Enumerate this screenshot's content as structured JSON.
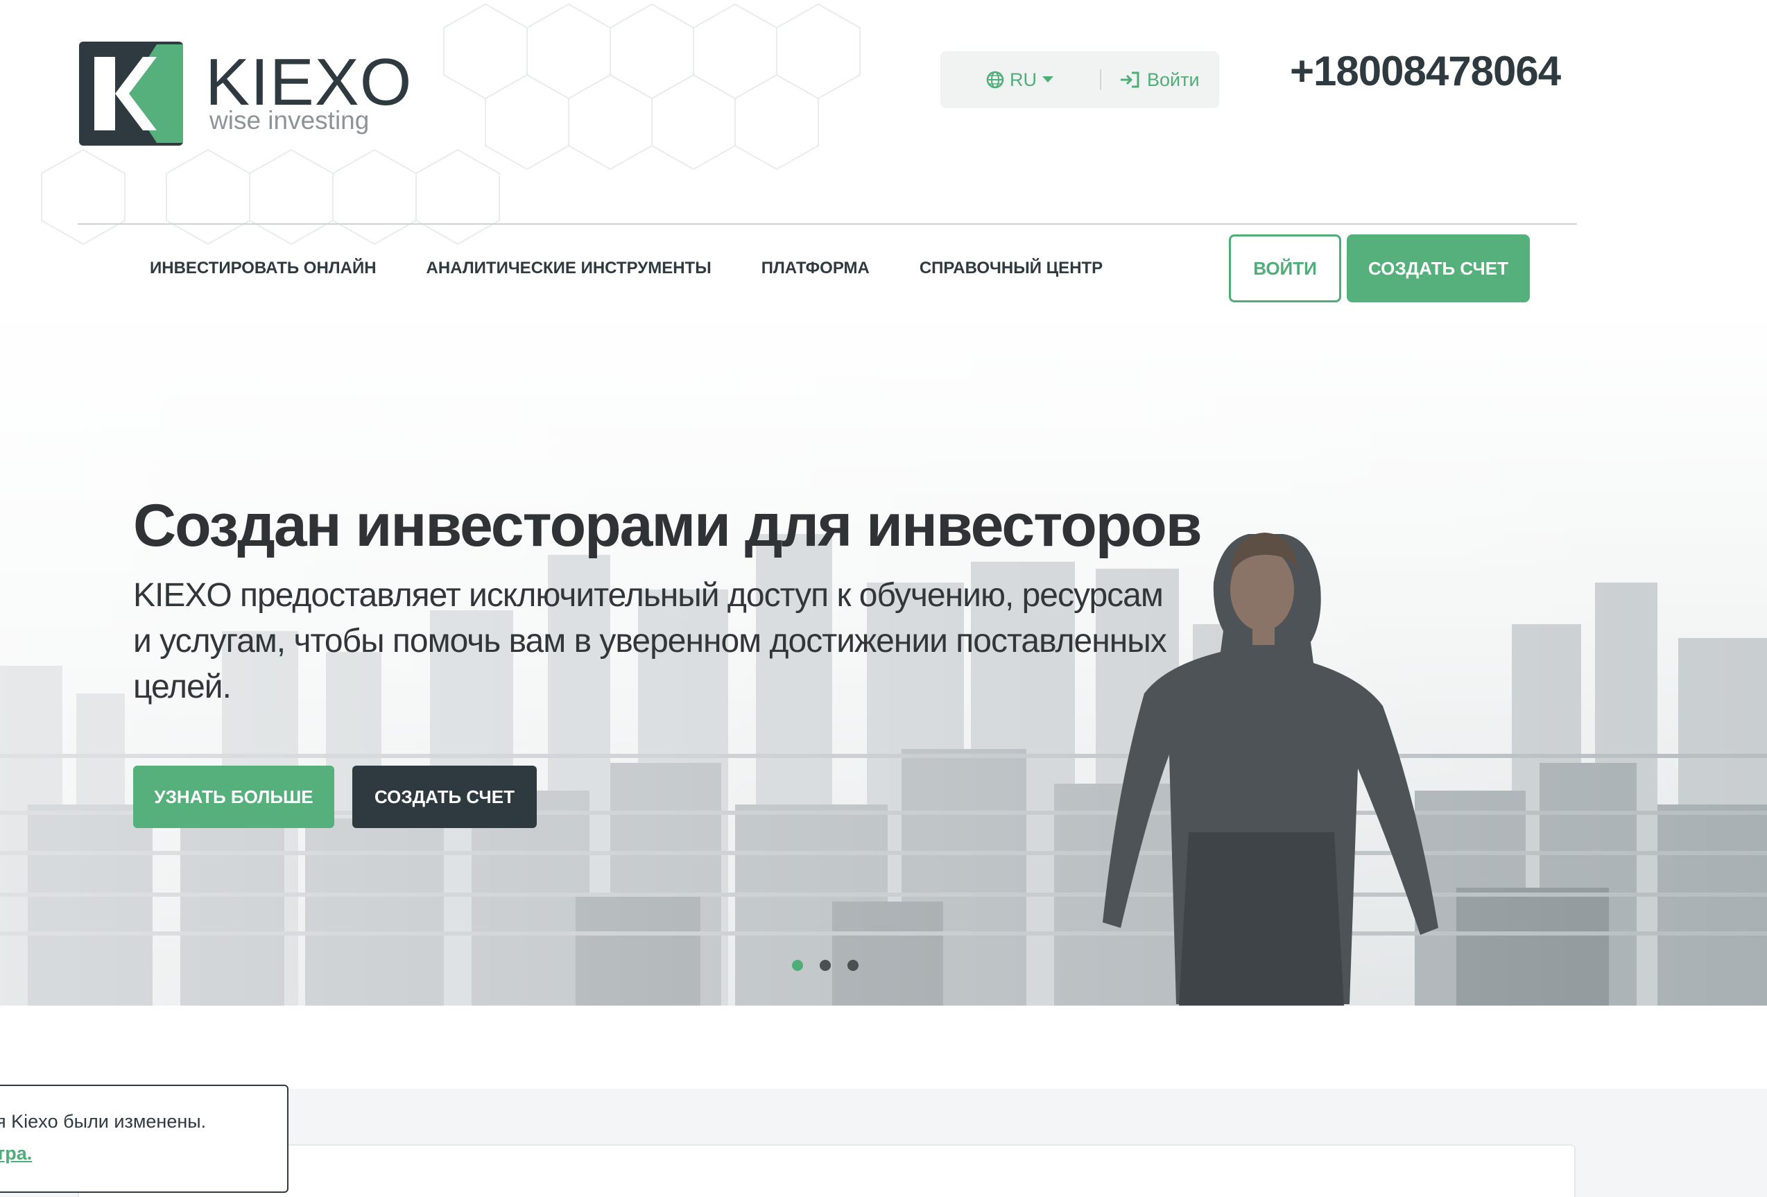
{
  "brand": {
    "name": "KIEXO",
    "tagline": "wise investing",
    "accent_color": "#55b07c",
    "dark_color": "#2f3a40"
  },
  "utility": {
    "language": "RU",
    "login_label": "Войти",
    "phone": "+18008478064"
  },
  "nav": {
    "items": [
      {
        "label": "ИНВЕСТИРОВАТЬ ОНЛАЙН"
      },
      {
        "label": "АНАЛИТИЧЕСКИЕ ИНСТРУМЕНТЫ"
      },
      {
        "label": "ПЛАТФОРМА"
      },
      {
        "label": "СПРАВОЧНЫЙ ЦЕНТР"
      }
    ],
    "login_button": "ВОЙТИ",
    "create_account_button": "СОЗДАТЬ СЧЕТ"
  },
  "hero": {
    "title": "Создан инвесторами для инвесторов",
    "subtitle": "KIEXO предоставляет исключительный доступ к обучению, ресурсам и услугам, чтобы помочь вам в уверенном достижении поставленных целей.",
    "learn_more_button": "УЗНАТЬ БОЛЬШЕ",
    "create_account_button": "СОЗДАТЬ СЧЕТ",
    "slides": 3,
    "active_slide": 1
  },
  "notice": {
    "text": "я Kiexo были изменены.",
    "link": "тра."
  }
}
